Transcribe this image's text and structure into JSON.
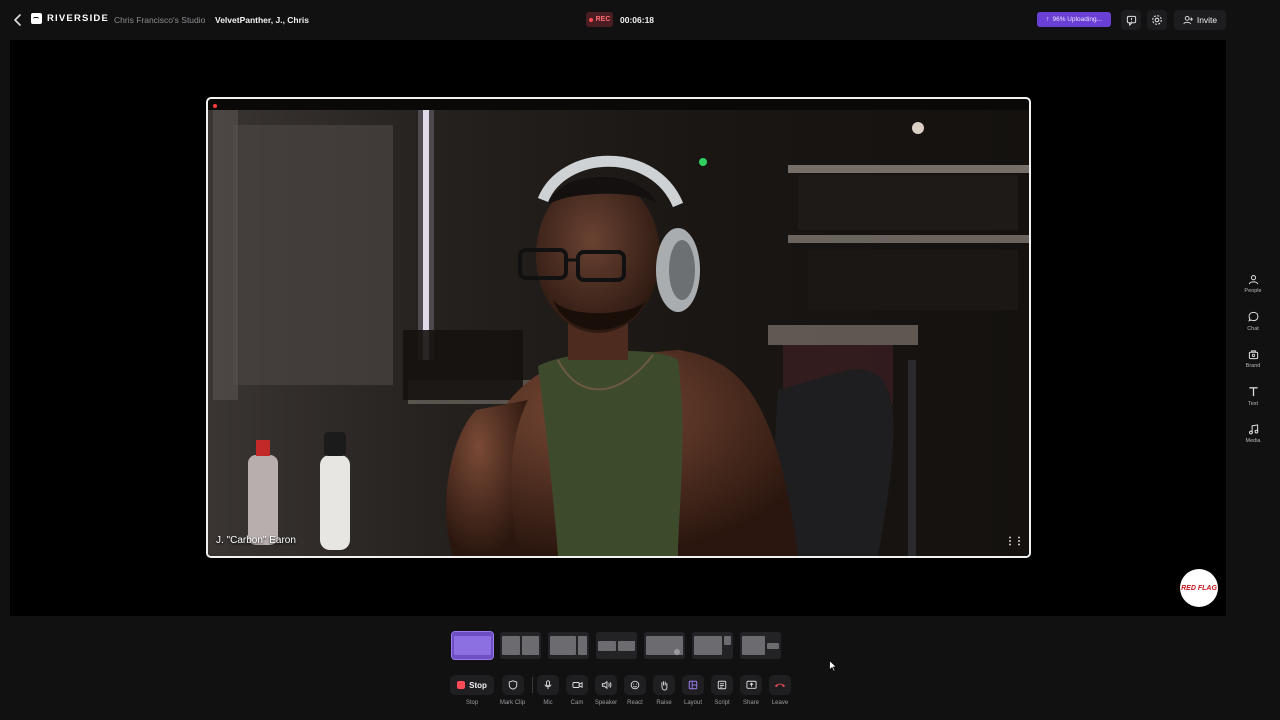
{
  "header": {
    "brand": "RIVERSIDE",
    "studio_name": "Chris Francisco's Studio",
    "session_name": "VelvetPanther, J., Chris",
    "rec_label": "REC",
    "timer": "00:06:18",
    "upload_status": "96% Uploading...",
    "invite_label": "Invite"
  },
  "stage": {
    "participant_name": "J. \"Carbon\" Earon",
    "brand_badge": "RED FLAG"
  },
  "sidebar": {
    "items": [
      {
        "label": "People",
        "icon": "people-icon"
      },
      {
        "label": "Chat",
        "icon": "chat-icon"
      },
      {
        "label": "Brand",
        "icon": "brand-icon"
      },
      {
        "label": "Text",
        "icon": "text-icon"
      },
      {
        "label": "Media",
        "icon": "media-icon"
      }
    ]
  },
  "controls": {
    "stop_button": "Stop",
    "items": [
      {
        "label": "Stop"
      },
      {
        "label": "Mark Clip"
      },
      {
        "label": "Mic"
      },
      {
        "label": "Cam"
      },
      {
        "label": "Speaker"
      },
      {
        "label": "React"
      },
      {
        "label": "Raise"
      },
      {
        "label": "Layout"
      },
      {
        "label": "Script"
      },
      {
        "label": "Share"
      },
      {
        "label": "Leave"
      }
    ]
  },
  "colors": {
    "accent": "#6f4fc4",
    "rec": "#ff4a55",
    "upload": "#6a3fd6",
    "leave": "#e5484d"
  }
}
